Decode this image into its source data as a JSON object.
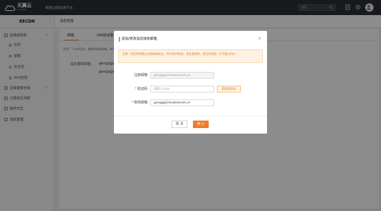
{
  "header": {
    "logo_main": "天翼云",
    "logo_sub": "e Cloud",
    "nav_title": "新建边缘加速节点",
    "search_placeholder": "搜索"
  },
  "sidebar": {
    "title": "EECDN",
    "items": [
      {
        "label": "边缘虚拟机",
        "icon": "server-icon",
        "expanded": true
      },
      {
        "label": "实例",
        "sub": true
      },
      {
        "label": "镜像",
        "sub": true
      },
      {
        "label": "安全组",
        "sub": true
      },
      {
        "label": "SSH密钥",
        "sub": true
      },
      {
        "label": "边缘镜像仓库",
        "icon": "repository-icon"
      },
      {
        "label": "计费常见列表",
        "icon": "billing-icon"
      },
      {
        "label": "操作日志",
        "icon": "log-icon"
      },
      {
        "label": "消息管理",
        "icon": "message-icon",
        "active": true
      }
    ]
  },
  "main": {
    "header_title": "消息管理",
    "tabs": [
      "邮箱",
      "IAM就道警"
    ],
    "description": "说明：1.支持添加、删除和修改邮箱，单次……",
    "receive_label": "消息接收邮箱：",
    "receive_values": [
      "gengq@ch",
      "gengq@ch"
    ]
  },
  "modal": {
    "title": "添加/修改消息接收邮箱",
    "close_symbol": "×",
    "notice": "注意：验证码将通过注册邮箱发送，30分钟内有效。请注意查收，验证码获取一天不超过3次！",
    "fields": {
      "registered_email_label": "注册邮箱",
      "registered_email_value": "gengq@chinatelecom.cn",
      "code_label": "验证码",
      "code_placeholder": "请输入code",
      "get_code_button": "获取验证码",
      "new_email_label": "修改邮箱",
      "new_email_value": "gengq@chinatelecom.cn"
    },
    "cancel_label": "取 消",
    "confirm_label": "确 认"
  },
  "colors": {
    "accent": "#f07b2a",
    "topbar": "#2b2f36"
  }
}
